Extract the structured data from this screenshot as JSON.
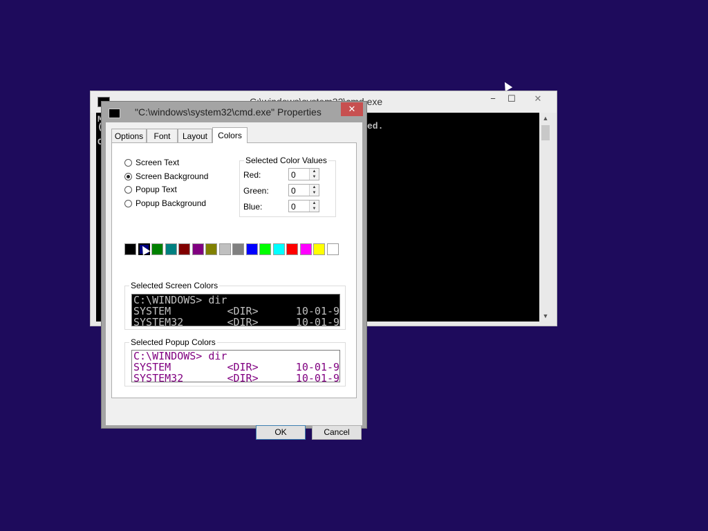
{
  "cmd_window": {
    "title": "C:\\windows\\system32\\cmd.exe",
    "console_fragment": "ed.",
    "console_left_fragments": [
      "M",
      "(",
      "C"
    ],
    "minimize_glyph": "−",
    "maximize_glyph": "☐",
    "close_glyph": "✕"
  },
  "dialog": {
    "title": "\"C:\\windows\\system32\\cmd.exe\" Properties",
    "close_glyph": "✕",
    "tabs": [
      {
        "label": "Options"
      },
      {
        "label": "Font"
      },
      {
        "label": "Layout"
      },
      {
        "label": "Colors",
        "active": true
      }
    ],
    "radio_options": [
      {
        "label": "Screen Text",
        "checked": false
      },
      {
        "label": "Screen Background",
        "checked": true
      },
      {
        "label": "Popup Text",
        "checked": false
      },
      {
        "label": "Popup Background",
        "checked": false
      }
    ],
    "color_values": {
      "group_title": "Selected Color Values",
      "red_label": "Red:",
      "red": "0",
      "green_label": "Green:",
      "green": "0",
      "blue_label": "Blue:",
      "blue": "0"
    },
    "palette": [
      {
        "name": "black",
        "hex": "#000000"
      },
      {
        "name": "navy",
        "hex": "#000080",
        "selected": true
      },
      {
        "name": "green",
        "hex": "#008000"
      },
      {
        "name": "teal",
        "hex": "#008080"
      },
      {
        "name": "maroon",
        "hex": "#800000"
      },
      {
        "name": "purple",
        "hex": "#800080"
      },
      {
        "name": "olive",
        "hex": "#808000"
      },
      {
        "name": "silver",
        "hex": "#c0c0c0"
      },
      {
        "name": "gray",
        "hex": "#808080"
      },
      {
        "name": "blue",
        "hex": "#0000ff"
      },
      {
        "name": "lime",
        "hex": "#00ff00"
      },
      {
        "name": "aqua",
        "hex": "#00ffff"
      },
      {
        "name": "red",
        "hex": "#ff0000"
      },
      {
        "name": "fuchsia",
        "hex": "#ff00ff"
      },
      {
        "name": "yellow",
        "hex": "#ffff00"
      },
      {
        "name": "white",
        "hex": "#ffffff"
      }
    ],
    "screen_preview": {
      "title": "Selected Screen Colors",
      "lines": [
        "C:\\WINDOWS> dir",
        "SYSTEM         <DIR>      10-01-9",
        "SYSTEM32       <DIR>      10-01-9"
      ],
      "fg": "#c0c0c0",
      "bg": "#000000"
    },
    "popup_preview": {
      "title": "Selected Popup Colors",
      "lines": [
        "C:\\WINDOWS> dir",
        "SYSTEM         <DIR>      10-01-9",
        "SYSTEM32       <DIR>      10-01-9"
      ],
      "fg": "#800080",
      "bg": "#ffffff"
    },
    "ok_label": "OK",
    "cancel_label": "Cancel"
  }
}
